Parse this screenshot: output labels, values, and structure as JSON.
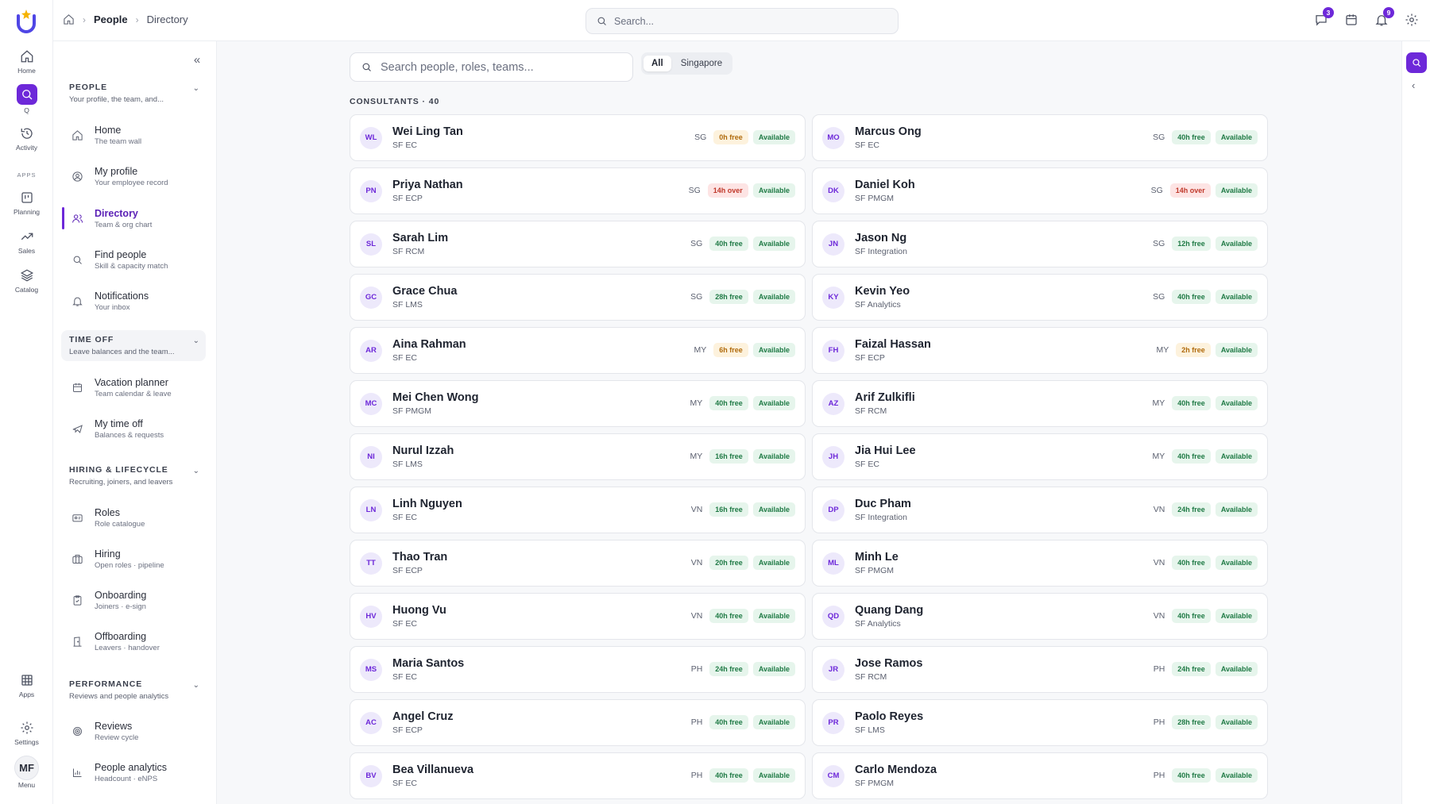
{
  "breadcrumb": {
    "home_icon": "home-icon",
    "level1": "People",
    "level2": "Directory"
  },
  "top_search": {
    "placeholder": "Search..."
  },
  "top_badges": {
    "messages": "3",
    "notifications": "9"
  },
  "rail": {
    "home": "Home",
    "q": "Q",
    "activity": "Activity",
    "apps_section": "APPS",
    "planning": "Planning",
    "sales": "Sales",
    "catalog": "Catalog",
    "apps": "Apps",
    "settings": "Settings",
    "user_initials": "MF",
    "menu": "Menu"
  },
  "sidebar": {
    "people": {
      "title": "PEOPLE",
      "sub": "Your profile, the team, and..."
    },
    "items_people": [
      {
        "label": "Home",
        "sub": "The team wall"
      },
      {
        "label": "My profile",
        "sub": "Your employee record"
      },
      {
        "label": "Directory",
        "sub": "Team & org chart"
      },
      {
        "label": "Find people",
        "sub": "Skill & capacity match"
      },
      {
        "label": "Notifications",
        "sub": "Your inbox"
      }
    ],
    "timeoff": {
      "title": "TIME OFF",
      "sub": "Leave balances and the team..."
    },
    "items_timeoff": [
      {
        "label": "Vacation planner",
        "sub": "Team calendar & leave"
      },
      {
        "label": "My time off",
        "sub": "Balances & requests"
      }
    ],
    "hiring": {
      "title": "HIRING & LIFECYCLE",
      "sub": "Recruiting, joiners, and leavers"
    },
    "items_hiring": [
      {
        "label": "Roles",
        "sub": "Role catalogue"
      },
      {
        "label": "Hiring",
        "sub": "Open roles · pipeline"
      },
      {
        "label": "Onboarding",
        "sub": "Joiners · e-sign"
      },
      {
        "label": "Offboarding",
        "sub": "Leavers · handover"
      }
    ],
    "performance": {
      "title": "PERFORMANCE",
      "sub": "Reviews and people analytics"
    },
    "items_performance": [
      {
        "label": "Reviews",
        "sub": "Review cycle"
      },
      {
        "label": "People analytics",
        "sub": "Headcount · eNPS"
      }
    ]
  },
  "main": {
    "search_placeholder": "Search people, roles, teams...",
    "filters": [
      "All",
      "Singapore"
    ],
    "active_filter": "All",
    "section_label": "CONSULTANTS · 40"
  },
  "colors": {
    "accent": "#6d28d9",
    "free": "#1f7a45",
    "low": "#b06a0b",
    "over": "#c0392b"
  },
  "people": [
    {
      "initials": "WL",
      "name": "Wei Ling Tan",
      "role": "SF EC",
      "country": "SG",
      "capacity": "0h free",
      "cap_type": "free-amber",
      "status": "Available"
    },
    {
      "initials": "MO",
      "name": "Marcus Ong",
      "role": "SF EC",
      "country": "SG",
      "capacity": "40h free",
      "cap_type": "free-green",
      "status": "Available"
    },
    {
      "initials": "PN",
      "name": "Priya Nathan",
      "role": "SF ECP",
      "country": "SG",
      "capacity": "14h over",
      "cap_type": "over-red",
      "status": "Available"
    },
    {
      "initials": "DK",
      "name": "Daniel Koh",
      "role": "SF PMGM",
      "country": "SG",
      "capacity": "14h over",
      "cap_type": "over-red",
      "status": "Available"
    },
    {
      "initials": "SL",
      "name": "Sarah Lim",
      "role": "SF RCM",
      "country": "SG",
      "capacity": "40h free",
      "cap_type": "free-green",
      "status": "Available"
    },
    {
      "initials": "JN",
      "name": "Jason Ng",
      "role": "SF Integration",
      "country": "SG",
      "capacity": "12h free",
      "cap_type": "free-green",
      "status": "Available"
    },
    {
      "initials": "GC",
      "name": "Grace Chua",
      "role": "SF LMS",
      "country": "SG",
      "capacity": "28h free",
      "cap_type": "free-green",
      "status": "Available"
    },
    {
      "initials": "KY",
      "name": "Kevin Yeo",
      "role": "SF Analytics",
      "country": "SG",
      "capacity": "40h free",
      "cap_type": "free-green",
      "status": "Available"
    },
    {
      "initials": "AR",
      "name": "Aina Rahman",
      "role": "SF EC",
      "country": "MY",
      "capacity": "6h free",
      "cap_type": "free-amber",
      "status": "Available"
    },
    {
      "initials": "FH",
      "name": "Faizal Hassan",
      "role": "SF ECP",
      "country": "MY",
      "capacity": "2h free",
      "cap_type": "free-amber",
      "status": "Available"
    },
    {
      "initials": "MC",
      "name": "Mei Chen Wong",
      "role": "SF PMGM",
      "country": "MY",
      "capacity": "40h free",
      "cap_type": "free-green",
      "status": "Available"
    },
    {
      "initials": "AZ",
      "name": "Arif Zulkifli",
      "role": "SF RCM",
      "country": "MY",
      "capacity": "40h free",
      "cap_type": "free-green",
      "status": "Available"
    },
    {
      "initials": "NI",
      "name": "Nurul Izzah",
      "role": "SF LMS",
      "country": "MY",
      "capacity": "16h free",
      "cap_type": "free-green",
      "status": "Available"
    },
    {
      "initials": "JH",
      "name": "Jia Hui Lee",
      "role": "SF EC",
      "country": "MY",
      "capacity": "40h free",
      "cap_type": "free-green",
      "status": "Available"
    },
    {
      "initials": "LN",
      "name": "Linh Nguyen",
      "role": "SF EC",
      "country": "VN",
      "capacity": "16h free",
      "cap_type": "free-green",
      "status": "Available"
    },
    {
      "initials": "DP",
      "name": "Duc Pham",
      "role": "SF Integration",
      "country": "VN",
      "capacity": "24h free",
      "cap_type": "free-green",
      "status": "Available"
    },
    {
      "initials": "TT",
      "name": "Thao Tran",
      "role": "SF ECP",
      "country": "VN",
      "capacity": "20h free",
      "cap_type": "free-green",
      "status": "Available"
    },
    {
      "initials": "ML",
      "name": "Minh Le",
      "role": "SF PMGM",
      "country": "VN",
      "capacity": "40h free",
      "cap_type": "free-green",
      "status": "Available"
    },
    {
      "initials": "HV",
      "name": "Huong Vu",
      "role": "SF EC",
      "country": "VN",
      "capacity": "40h free",
      "cap_type": "free-green",
      "status": "Available"
    },
    {
      "initials": "QD",
      "name": "Quang Dang",
      "role": "SF Analytics",
      "country": "VN",
      "capacity": "40h free",
      "cap_type": "free-green",
      "status": "Available"
    },
    {
      "initials": "MS",
      "name": "Maria Santos",
      "role": "SF EC",
      "country": "PH",
      "capacity": "24h free",
      "cap_type": "free-green",
      "status": "Available"
    },
    {
      "initials": "JR",
      "name": "Jose Ramos",
      "role": "SF RCM",
      "country": "PH",
      "capacity": "24h free",
      "cap_type": "free-green",
      "status": "Available"
    },
    {
      "initials": "AC",
      "name": "Angel Cruz",
      "role": "SF ECP",
      "country": "PH",
      "capacity": "40h free",
      "cap_type": "free-green",
      "status": "Available"
    },
    {
      "initials": "PR",
      "name": "Paolo Reyes",
      "role": "SF LMS",
      "country": "PH",
      "capacity": "28h free",
      "cap_type": "free-green",
      "status": "Available"
    },
    {
      "initials": "BV",
      "name": "Bea Villanueva",
      "role": "SF EC",
      "country": "PH",
      "capacity": "40h free",
      "cap_type": "free-green",
      "status": "Available"
    },
    {
      "initials": "CM",
      "name": "Carlo Mendoza",
      "role": "SF PMGM",
      "country": "PH",
      "capacity": "40h free",
      "cap_type": "free-green",
      "status": "Available"
    }
  ]
}
